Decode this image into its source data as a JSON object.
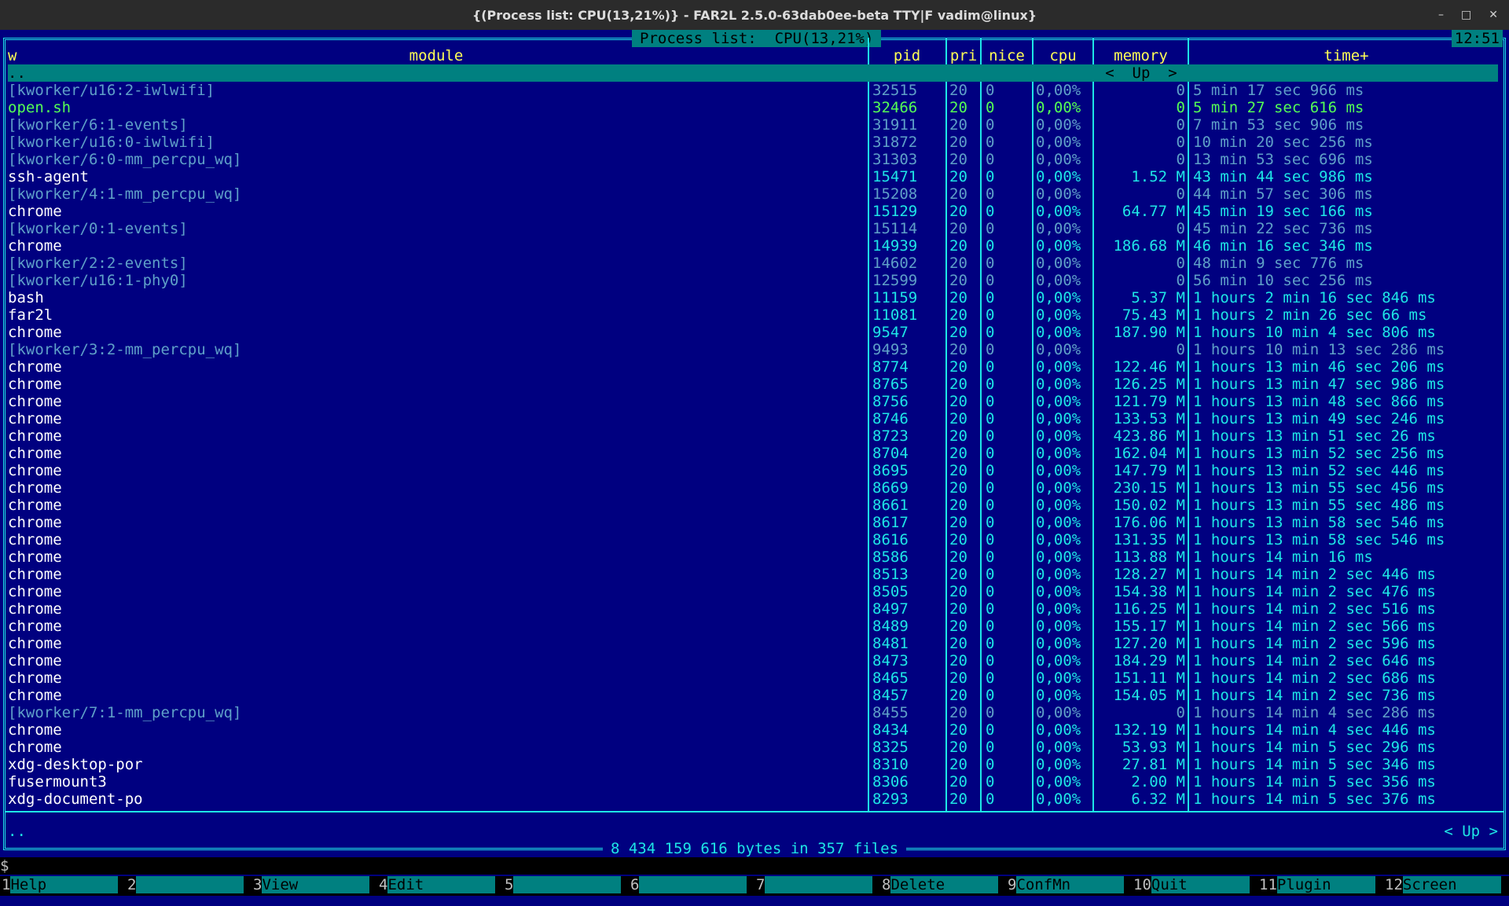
{
  "window": {
    "title": "{(Process list:  CPU(13,21%)} - FAR2L 2.5.0-63dab0ee-beta TTY|F vadim@linux}",
    "minimize": "–",
    "maximize": "□",
    "close": "✕"
  },
  "panel": {
    "title": "Process list:  CPU(13,21%)",
    "clock": "12:51",
    "headers": {
      "w": "w",
      "module": "module",
      "pid": "pid",
      "pri": "pri",
      "nice": "nice",
      "cpu": "cpu",
      "memory": "memory",
      "time": "time+"
    },
    "parent_row": {
      "name": "..",
      "memory": "<  Up  >"
    },
    "rows": [
      {
        "name": "[kworker/u16:2-iwlwifi]",
        "pid": "32515",
        "pri": "20",
        "nice": "0",
        "cpu": "0,00%",
        "mem": "0",
        "time": "5 min 17 sec 966 ms",
        "style": "dim"
      },
      {
        "name": "open.sh",
        "pid": "32466",
        "pri": "20",
        "nice": "0",
        "cpu": "0,00%",
        "mem": "0",
        "time": "5 min 27 sec 616 ms",
        "style": "hi"
      },
      {
        "name": "[kworker/6:1-events]",
        "pid": "31911",
        "pri": "20",
        "nice": "0",
        "cpu": "0,00%",
        "mem": "0",
        "time": "7 min 53 sec 906 ms",
        "style": "dim"
      },
      {
        "name": "[kworker/u16:0-iwlwifi]",
        "pid": "31872",
        "pri": "20",
        "nice": "0",
        "cpu": "0,00%",
        "mem": "0",
        "time": "10 min 20 sec 256 ms",
        "style": "dim"
      },
      {
        "name": "[kworker/6:0-mm_percpu_wq]",
        "pid": "31303",
        "pri": "20",
        "nice": "0",
        "cpu": "0,00%",
        "mem": "0",
        "time": "13 min 53 sec 696 ms",
        "style": "dim"
      },
      {
        "name": "ssh-agent",
        "pid": "15471",
        "pri": "20",
        "nice": "0",
        "cpu": "0,00%",
        "mem": "1.52 M",
        "time": "43 min 44 sec 986 ms",
        "style": "norm"
      },
      {
        "name": "[kworker/4:1-mm_percpu_wq]",
        "pid": "15208",
        "pri": "20",
        "nice": "0",
        "cpu": "0,00%",
        "mem": "0",
        "time": "44 min 57 sec 306 ms",
        "style": "dim"
      },
      {
        "name": "chrome",
        "pid": "15129",
        "pri": "20",
        "nice": "0",
        "cpu": "0,00%",
        "mem": "64.77 M",
        "time": "45 min 19 sec 166 ms",
        "style": "norm"
      },
      {
        "name": "[kworker/0:1-events]",
        "pid": "15114",
        "pri": "20",
        "nice": "0",
        "cpu": "0,00%",
        "mem": "0",
        "time": "45 min 22 sec 736 ms",
        "style": "dim"
      },
      {
        "name": "chrome",
        "pid": "14939",
        "pri": "20",
        "nice": "0",
        "cpu": "0,00%",
        "mem": "186.68 M",
        "time": "46 min 16 sec 346 ms",
        "style": "norm"
      },
      {
        "name": "[kworker/2:2-events]",
        "pid": "14602",
        "pri": "20",
        "nice": "0",
        "cpu": "0,00%",
        "mem": "0",
        "time": "48 min 9 sec 776 ms",
        "style": "dim"
      },
      {
        "name": "[kworker/u16:1-phy0]",
        "pid": "12599",
        "pri": "20",
        "nice": "0",
        "cpu": "0,00%",
        "mem": "0",
        "time": "56 min 10 sec 256 ms",
        "style": "dim"
      },
      {
        "name": "bash",
        "pid": "11159",
        "pri": "20",
        "nice": "0",
        "cpu": "0,00%",
        "mem": "5.37 M",
        "time": "1 hours 2 min 16 sec 846 ms",
        "style": "norm"
      },
      {
        "name": "far2l",
        "pid": "11081",
        "pri": "20",
        "nice": "0",
        "cpu": "0,00%",
        "mem": "75.43 M",
        "time": "1 hours 2 min 26 sec 66 ms",
        "style": "norm"
      },
      {
        "name": "chrome",
        "pid": "9547",
        "pri": "20",
        "nice": "0",
        "cpu": "0,00%",
        "mem": "187.90 M",
        "time": "1 hours 10 min 4 sec 806 ms",
        "style": "norm"
      },
      {
        "name": "[kworker/3:2-mm_percpu_wq]",
        "pid": "9493",
        "pri": "20",
        "nice": "0",
        "cpu": "0,00%",
        "mem": "0",
        "time": "1 hours 10 min 13 sec 286 ms",
        "style": "dim"
      },
      {
        "name": "chrome",
        "pid": "8774",
        "pri": "20",
        "nice": "0",
        "cpu": "0,00%",
        "mem": "122.46 M",
        "time": "1 hours 13 min 46 sec 206 ms",
        "style": "norm"
      },
      {
        "name": "chrome",
        "pid": "8765",
        "pri": "20",
        "nice": "0",
        "cpu": "0,00%",
        "mem": "126.25 M",
        "time": "1 hours 13 min 47 sec 986 ms",
        "style": "norm"
      },
      {
        "name": "chrome",
        "pid": "8756",
        "pri": "20",
        "nice": "0",
        "cpu": "0,00%",
        "mem": "121.79 M",
        "time": "1 hours 13 min 48 sec 866 ms",
        "style": "norm"
      },
      {
        "name": "chrome",
        "pid": "8746",
        "pri": "20",
        "nice": "0",
        "cpu": "0,00%",
        "mem": "133.53 M",
        "time": "1 hours 13 min 49 sec 246 ms",
        "style": "norm"
      },
      {
        "name": "chrome",
        "pid": "8723",
        "pri": "20",
        "nice": "0",
        "cpu": "0,00%",
        "mem": "423.86 M",
        "time": "1 hours 13 min 51 sec 26 ms",
        "style": "norm"
      },
      {
        "name": "chrome",
        "pid": "8704",
        "pri": "20",
        "nice": "0",
        "cpu": "0,00%",
        "mem": "162.04 M",
        "time": "1 hours 13 min 52 sec 256 ms",
        "style": "norm"
      },
      {
        "name": "chrome",
        "pid": "8695",
        "pri": "20",
        "nice": "0",
        "cpu": "0,00%",
        "mem": "147.79 M",
        "time": "1 hours 13 min 52 sec 446 ms",
        "style": "norm"
      },
      {
        "name": "chrome",
        "pid": "8669",
        "pri": "20",
        "nice": "0",
        "cpu": "0,00%",
        "mem": "230.15 M",
        "time": "1 hours 13 min 55 sec 456 ms",
        "style": "norm"
      },
      {
        "name": "chrome",
        "pid": "8661",
        "pri": "20",
        "nice": "0",
        "cpu": "0,00%",
        "mem": "150.02 M",
        "time": "1 hours 13 min 55 sec 486 ms",
        "style": "norm"
      },
      {
        "name": "chrome",
        "pid": "8617",
        "pri": "20",
        "nice": "0",
        "cpu": "0,00%",
        "mem": "176.06 M",
        "time": "1 hours 13 min 58 sec 546 ms",
        "style": "norm"
      },
      {
        "name": "chrome",
        "pid": "8616",
        "pri": "20",
        "nice": "0",
        "cpu": "0,00%",
        "mem": "131.35 M",
        "time": "1 hours 13 min 58 sec 546 ms",
        "style": "norm"
      },
      {
        "name": "chrome",
        "pid": "8586",
        "pri": "20",
        "nice": "0",
        "cpu": "0,00%",
        "mem": "113.88 M",
        "time": "1 hours 14 min 16 ms",
        "style": "norm"
      },
      {
        "name": "chrome",
        "pid": "8513",
        "pri": "20",
        "nice": "0",
        "cpu": "0,00%",
        "mem": "128.27 M",
        "time": "1 hours 14 min 2 sec 446 ms",
        "style": "norm"
      },
      {
        "name": "chrome",
        "pid": "8505",
        "pri": "20",
        "nice": "0",
        "cpu": "0,00%",
        "mem": "154.38 M",
        "time": "1 hours 14 min 2 sec 476 ms",
        "style": "norm"
      },
      {
        "name": "chrome",
        "pid": "8497",
        "pri": "20",
        "nice": "0",
        "cpu": "0,00%",
        "mem": "116.25 M",
        "time": "1 hours 14 min 2 sec 516 ms",
        "style": "norm"
      },
      {
        "name": "chrome",
        "pid": "8489",
        "pri": "20",
        "nice": "0",
        "cpu": "0,00%",
        "mem": "155.17 M",
        "time": "1 hours 14 min 2 sec 566 ms",
        "style": "norm"
      },
      {
        "name": "chrome",
        "pid": "8481",
        "pri": "20",
        "nice": "0",
        "cpu": "0,00%",
        "mem": "127.20 M",
        "time": "1 hours 14 min 2 sec 596 ms",
        "style": "norm"
      },
      {
        "name": "chrome",
        "pid": "8473",
        "pri": "20",
        "nice": "0",
        "cpu": "0,00%",
        "mem": "184.29 M",
        "time": "1 hours 14 min 2 sec 646 ms",
        "style": "norm"
      },
      {
        "name": "chrome",
        "pid": "8465",
        "pri": "20",
        "nice": "0",
        "cpu": "0,00%",
        "mem": "151.11 M",
        "time": "1 hours 14 min 2 sec 686 ms",
        "style": "norm"
      },
      {
        "name": "chrome",
        "pid": "8457",
        "pri": "20",
        "nice": "0",
        "cpu": "0,00%",
        "mem": "154.05 M",
        "time": "1 hours 14 min 2 sec 736 ms",
        "style": "norm"
      },
      {
        "name": "[kworker/7:1-mm_percpu_wq]",
        "pid": "8455",
        "pri": "20",
        "nice": "0",
        "cpu": "0,00%",
        "mem": "0",
        "time": "1 hours 14 min 4 sec 286 ms",
        "style": "dim"
      },
      {
        "name": "chrome",
        "pid": "8434",
        "pri": "20",
        "nice": "0",
        "cpu": "0,00%",
        "mem": "132.19 M",
        "time": "1 hours 14 min 4 sec 446 ms",
        "style": "norm"
      },
      {
        "name": "chrome",
        "pid": "8325",
        "pri": "20",
        "nice": "0",
        "cpu": "0,00%",
        "mem": "53.93 M",
        "time": "1 hours 14 min 5 sec 296 ms",
        "style": "norm"
      },
      {
        "name": "xdg-desktop-por",
        "pid": "8310",
        "pri": "20",
        "nice": "0",
        "cpu": "0,00%",
        "mem": "27.81 M",
        "time": "1 hours 14 min 5 sec 346 ms",
        "style": "norm"
      },
      {
        "name": "fusermount3",
        "pid": "8306",
        "pri": "20",
        "nice": "0",
        "cpu": "0,00%",
        "mem": "2.00 M",
        "time": "1 hours 14 min 5 sec 356 ms",
        "style": "norm"
      },
      {
        "name": "xdg-document-po",
        "pid": "8293",
        "pri": "20",
        "nice": "0",
        "cpu": "0,00%",
        "mem": "6.32 M",
        "time": "1 hours 14 min 5 sec 376 ms",
        "style": "norm"
      }
    ],
    "info_name": "..",
    "info_right": "<  Up  >",
    "totals": "8 434 159 616 bytes in 357 files"
  },
  "cmdline": {
    "prompt": "$"
  },
  "keybar": [
    {
      "num": "1",
      "label": "Help"
    },
    {
      "num": "2",
      "label": ""
    },
    {
      "num": "3",
      "label": "View"
    },
    {
      "num": "4",
      "label": "Edit"
    },
    {
      "num": "5",
      "label": ""
    },
    {
      "num": "6",
      "label": ""
    },
    {
      "num": "7",
      "label": ""
    },
    {
      "num": "8",
      "label": "Delete"
    },
    {
      "num": "9",
      "label": "ConfMn"
    },
    {
      "num": "10",
      "label": "Quit"
    },
    {
      "num": "11",
      "label": "Plugin"
    },
    {
      "num": "12",
      "label": "Screen"
    }
  ],
  "colors": {
    "background": "#000080",
    "frame": "#1ee6e6",
    "header": "#ffff55",
    "selection": "#008080",
    "executable": "#55ff55",
    "kernel_thread": "#5fa0c8"
  }
}
